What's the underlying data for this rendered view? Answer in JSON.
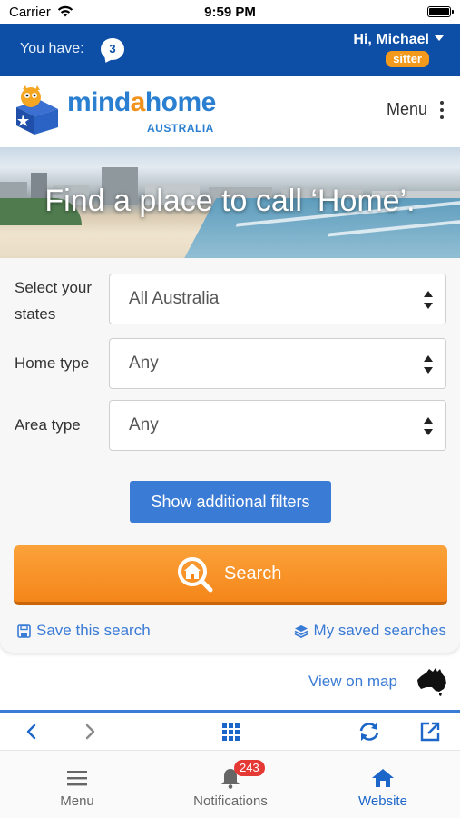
{
  "status_bar": {
    "carrier": "Carrier",
    "time": "9:59 PM"
  },
  "user_bar": {
    "you_have": "You have:",
    "message_count": "3",
    "greeting": "Hi, Michael",
    "role": "sitter"
  },
  "header": {
    "logo_part1": "mind",
    "logo_part2": "a",
    "logo_part3": "home",
    "logo_sub": "AUSTRALIA",
    "menu_label": "Menu"
  },
  "hero": {
    "title": "Find a place to call ‘Home’."
  },
  "search_form": {
    "state_label": "Select your states",
    "state_value": "All Australia",
    "home_type_label": "Home type",
    "home_type_value": "Any",
    "area_type_label": "Area type",
    "area_type_value": "Any",
    "filters_button": "Show additional filters",
    "search_button": "Search",
    "save_search": "Save this search",
    "saved_searches": "My saved searches"
  },
  "map_link": "View on map",
  "browser_toolbar": {
    "icons": [
      "back-icon",
      "forward-icon",
      "grid-icon",
      "refresh-icon",
      "open-external-icon"
    ]
  },
  "tab_bar": {
    "menu": "Menu",
    "notifications": "Notifications",
    "notifications_count": "243",
    "website": "Website"
  },
  "colors": {
    "brand_blue": "#0d4fa6",
    "link_blue": "#3a7bd5",
    "accent_orange": "#f5861a",
    "badge_red": "#e53935"
  }
}
